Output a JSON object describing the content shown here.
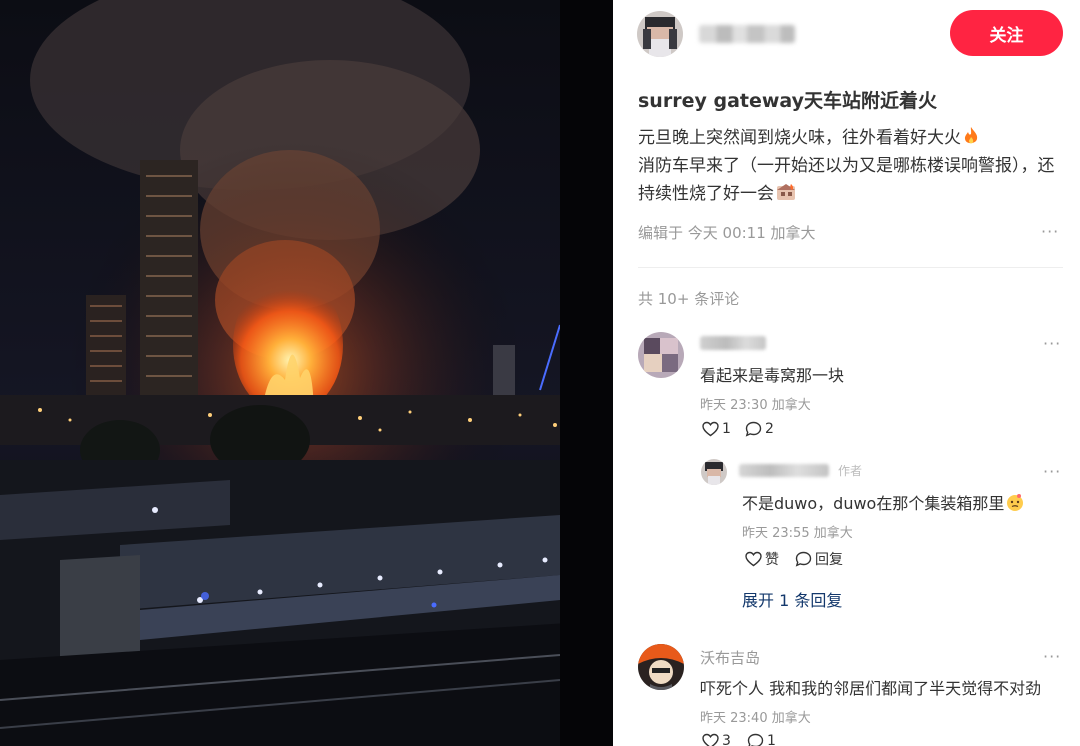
{
  "post": {
    "follow_label": "关注",
    "title": "surrey gateway天车站附近着火",
    "body_line1": "元旦晚上突然闻到烧火味，往外看着好大火",
    "body_line2": "消防车早来了（一开始还以为又是哪栋楼误响警报），还持续性烧了好一会",
    "edited": "编辑于 今天 00:11 加拿大",
    "more": "···"
  },
  "comments_header": {
    "count_label": "共 10+ 条评论"
  },
  "comments": [
    {
      "text": "看起来是毒窝那一块",
      "meta": "昨天 23:30 加拿大",
      "likes": "1",
      "replies": "2",
      "more": "···"
    },
    {
      "text": "吓死个人 我和我的邻居们都闻了半天觉得不对劲",
      "name": "沃布吉岛",
      "meta": "昨天 23:40 加拿大",
      "likes": "3",
      "replies": "1",
      "more": "···"
    }
  ],
  "reply": {
    "badge": "作者",
    "text": "不是duwo，duwo在那个集装箱那里",
    "meta": "昨天 23:55 加拿大",
    "like_label": "赞",
    "reply_label": "回复",
    "more": "···"
  },
  "expand_label": "展开 1 条回复",
  "colors": {
    "accent": "#ff2442",
    "link": "#13386c",
    "muted": "#999999"
  }
}
